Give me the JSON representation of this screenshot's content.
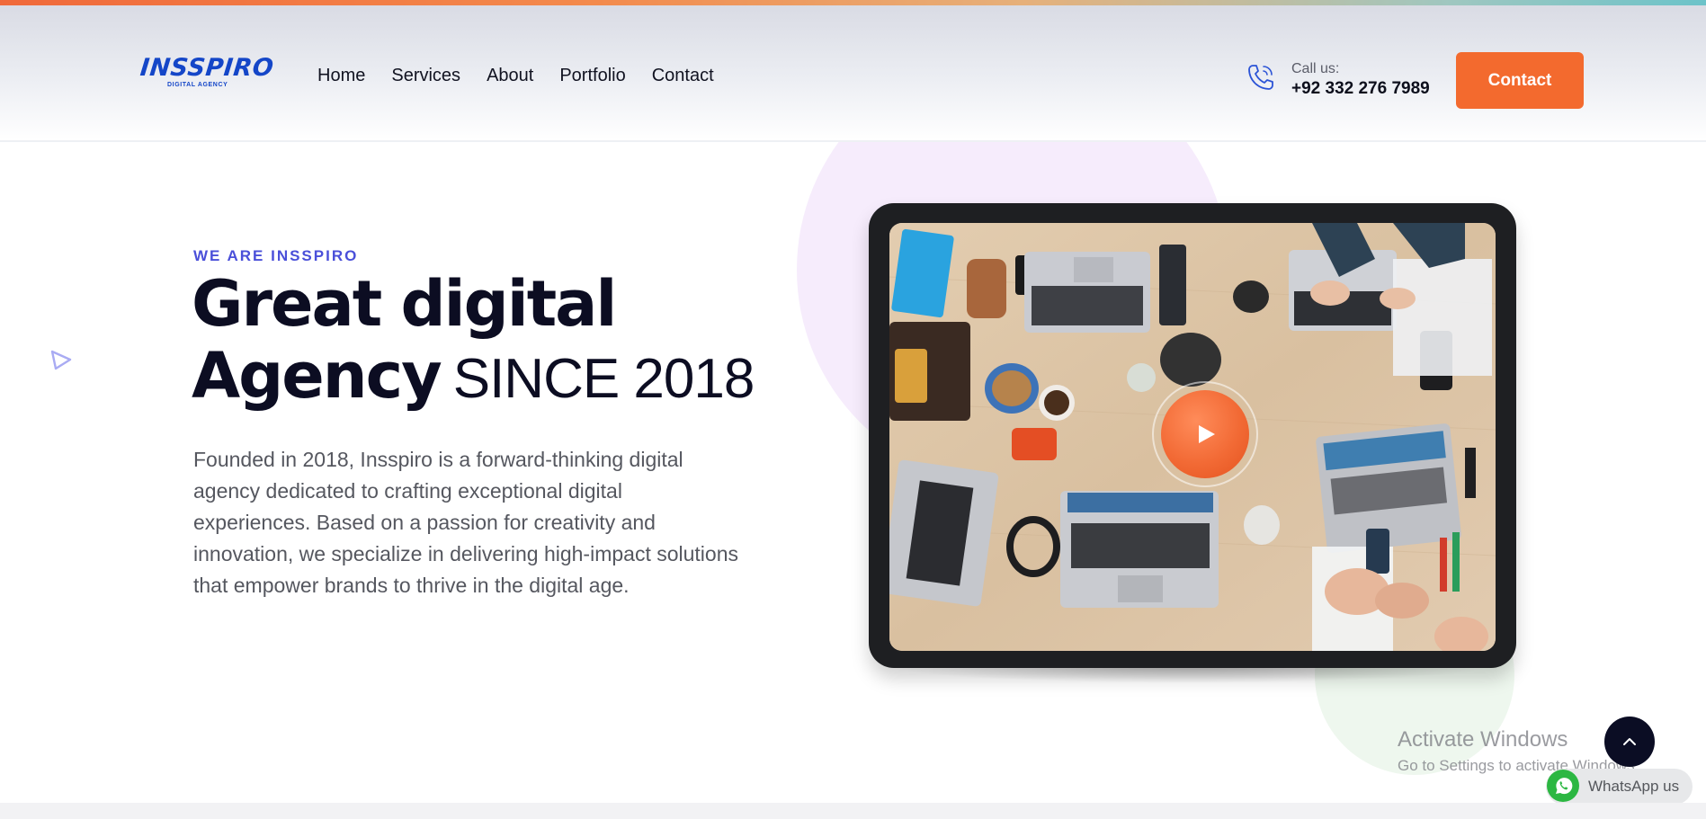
{
  "stripe_colors": [
    "#f0693a",
    "#f38a4c",
    "#e6b07a",
    "#9fc7c0",
    "#6cc3c9"
  ],
  "logo": {
    "name": "INSSPIRO",
    "tagline": "DIGITAL AGENCY",
    "color": "#1446c8"
  },
  "nav": {
    "items": [
      {
        "label": "Home"
      },
      {
        "label": "Services"
      },
      {
        "label": "About"
      },
      {
        "label": "Portfolio"
      },
      {
        "label": "Contact"
      }
    ]
  },
  "call": {
    "icon": "phone-icon",
    "label": "Call us:",
    "number": "+92 332 276 7989"
  },
  "header_button": {
    "label": "Contact",
    "color": "#f36a2e"
  },
  "hero": {
    "eyebrow": "WE ARE INSSPIRO",
    "headline_line1": "Great digital",
    "headline_line2_bold": "Agency",
    "headline_line2_light": "SINCE 2018",
    "description": "Founded in 2018, Insspiro is a forward-thinking digital agency dedicated to crafting exceptional digital experiences. Based on a passion for creativity and innovation, we specialize in delivering high-impact solutions that empower brands to thrive in the digital age.",
    "accent_color": "#4a4fd9"
  },
  "video": {
    "play_icon": "play-icon",
    "play_color": "#f26a35"
  },
  "windows_watermark": {
    "title": "Activate Windows",
    "subtitle": "Go to Settings to activate Windows."
  },
  "scroll_top": {
    "icon": "chevron-up-icon"
  },
  "whatsapp": {
    "icon": "whatsapp-icon",
    "label": "WhatsApp us"
  }
}
